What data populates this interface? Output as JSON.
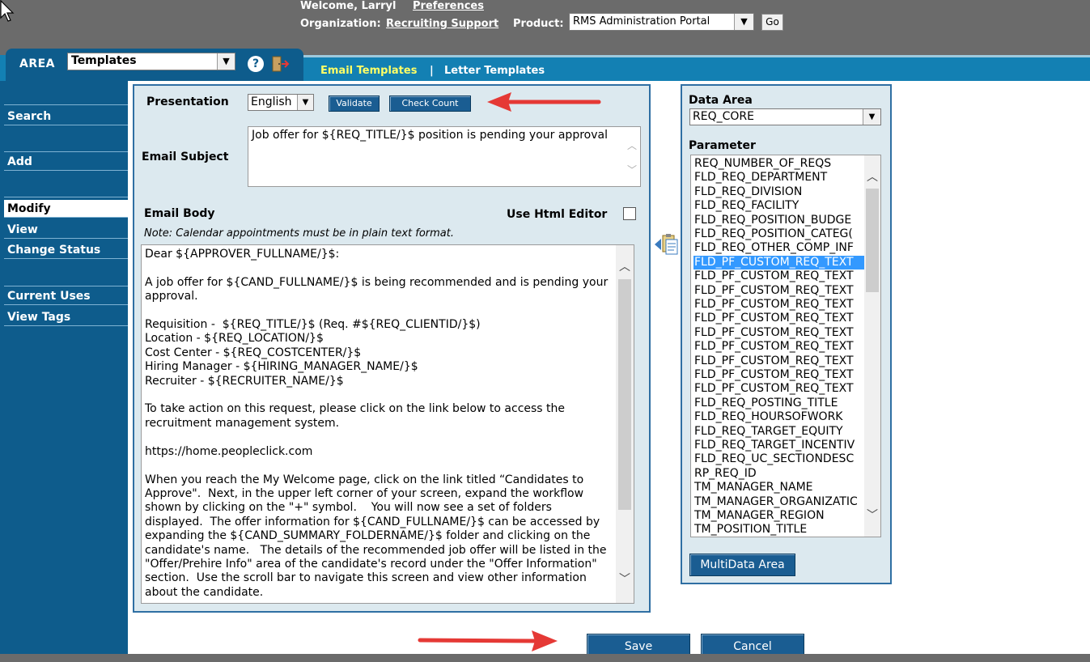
{
  "header": {
    "welcome": "Welcome, Larryl",
    "preferences_link": "Preferences",
    "organization_label": "Organization:",
    "organization_value": "Recruiting Support",
    "product_label": "Product:",
    "product_selected": "RMS Administration Portal",
    "go_button": "Go"
  },
  "area": {
    "label": "AREA",
    "selected": "Templates",
    "help_icon": "?"
  },
  "tabs": [
    {
      "label": "Email Templates",
      "active": true
    },
    {
      "label": "Letter Templates",
      "active": false
    }
  ],
  "tab_separator": "|",
  "sidebar": {
    "items": [
      {
        "label": "Search"
      },
      {
        "label": "Add"
      },
      {
        "label": "Modify",
        "active": true
      },
      {
        "label": "View"
      },
      {
        "label": "Change Status"
      },
      {
        "label": "Current Uses"
      },
      {
        "label": "View Tags"
      }
    ]
  },
  "form": {
    "presentation_label": "Presentation",
    "presentation_value": "English",
    "validate_button": "Validate",
    "check_count_button": "Check Count",
    "subject_label": "Email Subject",
    "subject_value": "Job offer for ${REQ_TITLE/}$ position is pending your approval",
    "body_label": "Email Body",
    "html_editor_label": "Use Html Editor",
    "html_editor_checked": false,
    "note": "Note: Calendar appointments must be in plain text format.",
    "body_value": "Dear ${APPROVER_FULLNAME/}$:\n\nA job offer for ${CAND_FULLNAME/}$ is being recommended and is pending your approval.\n\nRequisition -  ${REQ_TITLE/}$ (Req. #${REQ_CLIENTID/}$)\nLocation - ${REQ_LOCATION/}$\nCost Center - ${REQ_COSTCENTER/}$\nHiring Manager - ${HIRING_MANAGER_NAME/}$\nRecruiter - ${RECRUITER_NAME/}$\n\nTo take action on this request, please click on the link below to access the recruitment management system.\n\nhttps://home.peopleclick.com\n\nWhen you reach the My Welcome page, click on the link titled “Candidates to Approve\".  Next, in the upper left corner of your screen, expand the workflow shown by clicking on the \"+\" symbol.    You will now see a set of folders displayed.  The offer information for ${CAND_FULLNAME/}$ can be accessed by expanding the ${CAND_SUMMARY_FOLDERNAME/}$ folder and clicking on the candidate's name.   The details of the recommended job offer will be listed in the \"Offer/Prehire Info\" area of the candidate's record under the \"Offer Information\" section.  Use the scroll bar to navigate this screen and view other information about the candidate."
  },
  "data_area": {
    "label": "Data Area",
    "selected": "REQ_CORE",
    "parameter_label": "Parameter",
    "parameters": [
      "REQ_NUMBER_OF_REQS",
      "FLD_REQ_DEPARTMENT",
      "FLD_REQ_DIVISION",
      "FLD_REQ_FACILITY",
      "FLD_REQ_POSITION_BUDGE",
      "FLD_REQ_POSITION_CATEG(",
      "FLD_REQ_OTHER_COMP_INF",
      "FLD_PF_CUSTOM_REQ_TEXT",
      "FLD_PF_CUSTOM_REQ_TEXT",
      "FLD_PF_CUSTOM_REQ_TEXT",
      "FLD_PF_CUSTOM_REQ_TEXT",
      "FLD_PF_CUSTOM_REQ_TEXT",
      "FLD_PF_CUSTOM_REQ_TEXT",
      "FLD_PF_CUSTOM_REQ_TEXT",
      "FLD_PF_CUSTOM_REQ_TEXT",
      "FLD_PF_CUSTOM_REQ_TEXT",
      "FLD_PF_CUSTOM_REQ_TEXT",
      "FLD_REQ_POSTING_TITLE",
      "FLD_REQ_HOURSOFWORK",
      "FLD_REQ_TARGET_EQUITY",
      "FLD_REQ_TARGET_INCENTIV",
      "FLD_REQ_UC_SECTIONDESC",
      "RP_REQ_ID",
      "TM_MANAGER_NAME",
      "TM_MANAGER_ORGANIZATIC",
      "TM_MANAGER_REGION",
      "TM_POSITION_TITLE"
    ],
    "selected_index": 7,
    "multi_button": "MultiData Area"
  },
  "actions": {
    "save": "Save",
    "cancel": "Cancel"
  },
  "colors": {
    "header_gray": "#6b6b6b",
    "nav_blue": "#0e5c8c",
    "tab_blue": "#1380b3",
    "panel_bg": "#dce9ef",
    "active_tab_text": "#ffff66",
    "annotation_red": "#e53935"
  }
}
